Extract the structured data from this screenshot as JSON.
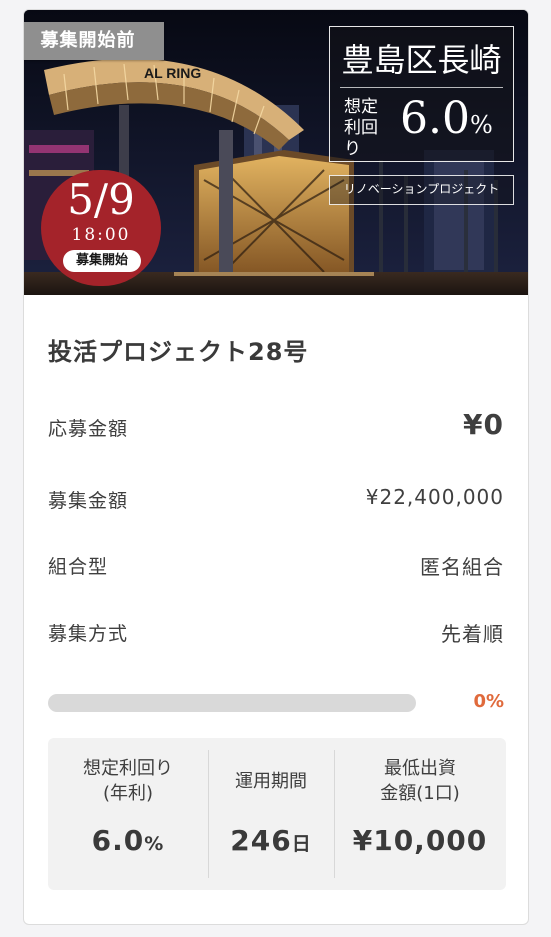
{
  "card": {
    "status_tab": "募集開始前",
    "image": {
      "sign_text": "AL RING",
      "location": "豊島区長崎",
      "yield_label": "想定\n利回り",
      "yield_number": "6.0",
      "yield_unit": "%",
      "subtitle": "リノベーションプロジェクト",
      "date": "5/9",
      "time": "18:00",
      "start_label": "募集開始"
    },
    "title": "投活プロジェクト28号",
    "rows": [
      {
        "label": "応募金額",
        "value": "¥0"
      },
      {
        "label": "募集金額",
        "value": "¥22,400,000"
      },
      {
        "label": "組合型",
        "value": "匿名組合"
      },
      {
        "label": "募集方式",
        "value": "先着順"
      }
    ],
    "progress": {
      "fraction": 0,
      "text": "0%"
    },
    "stats": [
      {
        "label": "想定利回り\n(年利)",
        "value": "6.0",
        "unit": "%"
      },
      {
        "label": "運用期間",
        "value": "246",
        "unit": "日"
      },
      {
        "label": "最低出資\n金額(1口)",
        "value": "¥10,000",
        "unit": ""
      }
    ]
  },
  "colors": {
    "accent": "#e06a3c",
    "badge_red": "#a4232a",
    "status_gray": "#8f8f8f",
    "stats_bg": "#f2f2f2"
  }
}
